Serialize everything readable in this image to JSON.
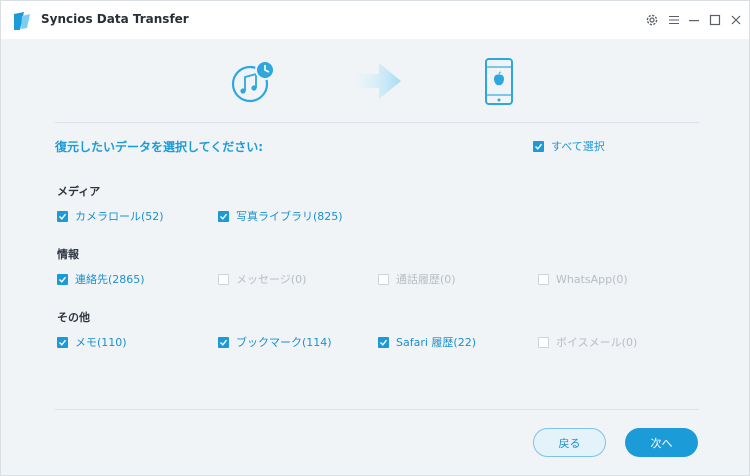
{
  "window": {
    "title": "Syncios Data Transfer"
  },
  "header": {
    "heading": "復元したいデータを選択してください:",
    "select_all": "すべて選択"
  },
  "sections": {
    "media": {
      "title": "メディア",
      "items": [
        {
          "label": "カメラロール(52)"
        },
        {
          "label": "写真ライブラリ(825)"
        }
      ]
    },
    "info": {
      "title": "情報",
      "items": [
        {
          "label": "連絡先(2865)"
        },
        {
          "label": "メッセージ(0)"
        },
        {
          "label": "通話履歴(0)"
        },
        {
          "label": "WhatsApp(0)"
        }
      ]
    },
    "other": {
      "title": "その他",
      "items": [
        {
          "label": "メモ(110)"
        },
        {
          "label": "ブックマーク(114)"
        },
        {
          "label": "Safari 履歴(22)"
        },
        {
          "label": "ボイスメール(0)"
        }
      ]
    }
  },
  "footer": {
    "back": "戻る",
    "next": "次へ"
  },
  "colors": {
    "accent": "#1b9bd7",
    "disabled": "#b7bdc4"
  }
}
